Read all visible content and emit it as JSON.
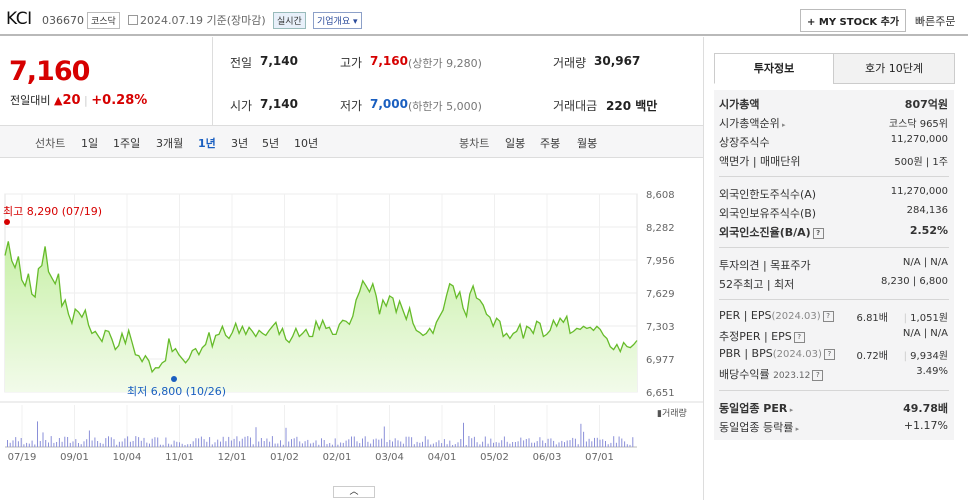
{
  "header": {
    "name": "KCI",
    "code": "036670",
    "market": "코스닥",
    "date": "2024.07.19",
    "basis": "기준(장마감)",
    "realtime": "실시간",
    "overview": "기업개요",
    "mystock": "MY STOCK 추가",
    "quick_order": "빠른주문"
  },
  "price": {
    "current": "7,160",
    "change_label": "전일대비",
    "change": "20",
    "change_pct": "+0.28%"
  },
  "summary": {
    "prev_label": "전일",
    "prev": "7,140",
    "high_label": "고가",
    "high": "7,160",
    "upper_label": "(상한가",
    "upper": "9,280)",
    "volume_label": "거래량",
    "volume": "30,967",
    "open_label": "시가",
    "open": "7,140",
    "low_label": "저가",
    "low": "7,000",
    "lower_label": "(하한가",
    "lower": "5,000)",
    "amount_label": "거래대금",
    "amount": "220 백만"
  },
  "periods": {
    "line_label": "선차트",
    "line": [
      "1일",
      "1주일",
      "3개월",
      "1년",
      "3년",
      "5년",
      "10년"
    ],
    "candle_label": "봉차트",
    "candle": [
      "일봉",
      "주봉",
      "월봉"
    ]
  },
  "tabs": {
    "info": "투자정보",
    "quote": "호가 10단계"
  },
  "info": {
    "mcap_label": "시가총액",
    "mcap": "807억원",
    "rank_label": "시가총액순위",
    "rank": "코스닥 965위",
    "shares_label": "상장주식수",
    "shares": "11,270,000",
    "par_label": "액면가 | 매매단위",
    "par": "500원 | 1주",
    "foreign_limit_label": "외국인한도주식수(A)",
    "foreign_limit": "11,270,000",
    "foreign_hold_label": "외국인보유주식수(B)",
    "foreign_hold": "284,136",
    "foreign_ratio_label": "외국인소진율(B/A)",
    "foreign_ratio": "2.52%",
    "opinion_label": "투자의견 | 목표주가",
    "opinion": "N/A | N/A",
    "w52_label": "52주최고 | 최저",
    "w52": "8,230 | 6,800",
    "per_label": "PER | EPS",
    "per_date": "(2024.03)",
    "per": "6.81배",
    "eps": "1,051원",
    "est_label": "추정PER | EPS",
    "est": "N/A | N/A",
    "pbr_label": "PBR | BPS",
    "pbr_date": "(2024.03)",
    "pbr": "0.72배",
    "bps": "9,934원",
    "div_label": "배당수익률",
    "div_date": "2023.12",
    "div": "3.49%",
    "ind_per_label": "동일업종 PER",
    "ind_per": "49.78배",
    "ind_rate_label": "동일업종 등락률",
    "ind_rate": "+1.17%"
  },
  "chart_data": {
    "type": "area",
    "y_ticks": [
      "8,608",
      "8,282",
      "7,956",
      "7,629",
      "7,303",
      "6,977",
      "6,651"
    ],
    "ylim": [
      6651,
      8608
    ],
    "x_ticks": [
      "07/19",
      "09/01",
      "10/04",
      "11/01",
      "12/01",
      "01/02",
      "02/01",
      "03/04",
      "04/01",
      "05/02",
      "06/03",
      "07/01"
    ],
    "max_label": "최고 8,290 (07/19)",
    "min_label": "최저 6,800 (10/26)",
    "volume_label": "거래량",
    "series": [
      {
        "values": [
          8000,
          8140,
          7950,
          7880,
          7990,
          7760,
          7700,
          7820,
          7620,
          7590,
          7870,
          7900,
          8090,
          7840,
          7780,
          7720,
          7820,
          7500,
          7560,
          7420,
          7330,
          7470,
          7440,
          7390,
          7460,
          7310,
          7230,
          7250,
          7200,
          7150,
          7260,
          7250,
          7170,
          7070,
          7110,
          7230,
          7130,
          7260,
          7140,
          7020,
          7010,
          6950,
          7010,
          6960,
          6850,
          6890,
          6890,
          6940,
          6960,
          7180,
          7050,
          7080,
          7020,
          6980,
          6940,
          6980,
          7060,
          7080,
          7020,
          7090,
          7120,
          7240,
          7100,
          7210,
          7220,
          7300,
          7210,
          7180,
          7240,
          7330,
          7230,
          7300,
          7220,
          7290,
          7250,
          7200,
          7260,
          7230,
          7210,
          7260,
          7300,
          7340,
          7220,
          7280,
          7170,
          7140,
          7200,
          7280,
          7200,
          7230,
          7270,
          7200,
          7200,
          7350,
          7270,
          7360,
          7280,
          7290,
          7220,
          7220,
          7320,
          7360,
          7350,
          7320,
          7400,
          7560,
          7640,
          7750,
          7700,
          7640,
          7720,
          7600,
          7420,
          7560,
          7500,
          7600,
          7580,
          7440,
          7550,
          7460,
          7370,
          7480,
          7330,
          7260,
          7240,
          7210,
          7230,
          7280,
          7230,
          7340,
          7400,
          7460,
          7600,
          7720,
          7700,
          7580,
          7640,
          7480,
          7400,
          7620,
          7700,
          7580,
          7560,
          7510,
          7420,
          7390,
          7300,
          7380,
          7350,
          7200,
          7230,
          7180,
          7230,
          7250,
          7320,
          7180,
          7300,
          7280,
          7230,
          7350,
          7330,
          7200,
          7220,
          7260,
          7360,
          7300,
          7380,
          7340,
          7400,
          7230,
          7250,
          7280,
          7270,
          7300,
          7280,
          7290,
          7260,
          7300,
          7270,
          7210,
          7180,
          7100,
          7070,
          7120,
          7050,
          7140,
          7100,
          7090,
          7120,
          7160
        ]
      }
    ]
  },
  "footer": {
    "toggle": "︿"
  }
}
